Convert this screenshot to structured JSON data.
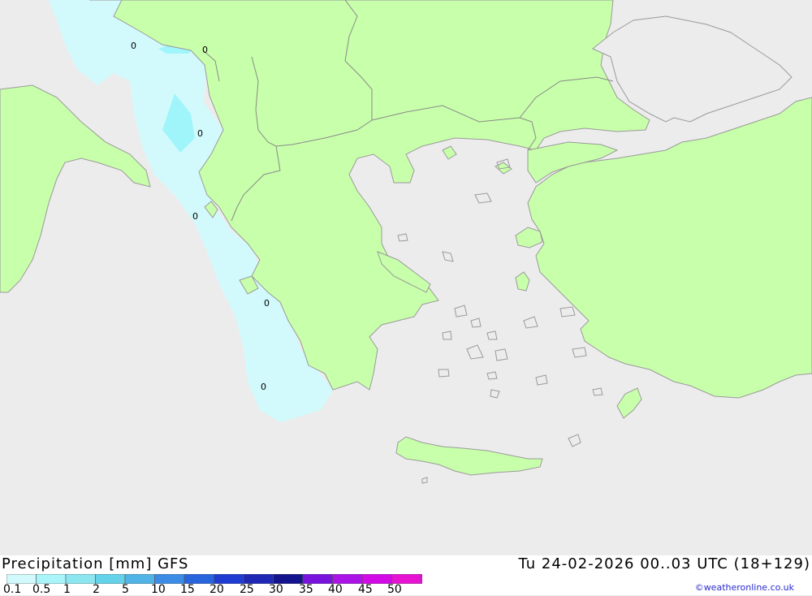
{
  "map": {
    "colors": {
      "sea": "#ececec",
      "land": "#c8ffaa",
      "coast": "#9a9a9a",
      "border": "#8a8a8a",
      "precip_light": "#d2fafc",
      "precip_mid": "#a0f5fa",
      "precip_strong": "#6ee6f0"
    },
    "station_values": [
      "0",
      "0",
      "0",
      "0",
      "0",
      "0"
    ]
  },
  "legend": {
    "title": "Precipitation [mm] GFS",
    "valid_time": "Tu 24-02-2026 00..03 UTC (18+129)",
    "scale": [
      "0.1",
      "0.5",
      "1",
      "2",
      "5",
      "10",
      "15",
      "20",
      "25",
      "30",
      "35",
      "40",
      "45",
      "50"
    ],
    "scale_colors": [
      "#d2fafc",
      "#aaf5fa",
      "#8ce6f0",
      "#64d2e8",
      "#50b4e6",
      "#3c8ce6",
      "#2864dc",
      "#1e3cd2",
      "#1e28b4",
      "#14148c",
      "#7814dc",
      "#aa14e6",
      "#d20ae6",
      "#e614d2",
      "#c814c8"
    ]
  },
  "credit": "©weatheronline.co.uk"
}
